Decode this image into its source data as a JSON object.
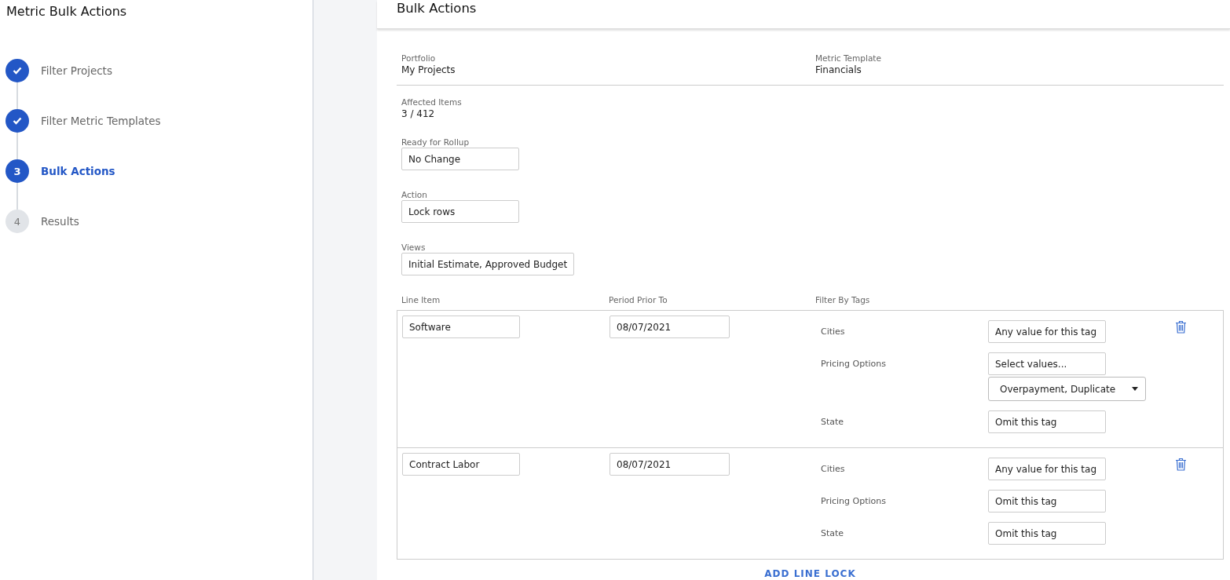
{
  "sidebar": {
    "title": "Metric Bulk Actions",
    "steps": [
      {
        "label": "Filter Projects",
        "completed": true,
        "selected": false
      },
      {
        "label": "Filter Metric Templates",
        "completed": true,
        "selected": false
      },
      {
        "marker": "3",
        "label": "Bulk Actions",
        "completed": false,
        "selected": true
      },
      {
        "marker": "4",
        "label": "Results",
        "completed": false,
        "selected": false
      }
    ]
  },
  "main": {
    "title": "Bulk Actions",
    "summary": [
      {
        "label": "Portfolio",
        "value": "My Projects"
      },
      {
        "label": "Metric Template",
        "value": "Financials"
      }
    ],
    "affected": {
      "label": "Affected Items",
      "value": "3 / 412"
    },
    "fields": [
      {
        "label": "Ready for Rollup",
        "value": "No Change"
      },
      {
        "label": "Action",
        "value": "Lock rows"
      },
      {
        "label": "Views",
        "value": "Initial Estimate, Approved Budget"
      }
    ],
    "table": {
      "columns": [
        "Line Item",
        "Period Prior To",
        "Filter By Tags"
      ],
      "rows": [
        {
          "line_item": "Software",
          "period": "08/07/2021",
          "tags": [
            {
              "label": "Cities",
              "controls": [
                {
                  "kind": "field",
                  "value": "Any value for this tag"
                }
              ]
            },
            {
              "label": "Pricing Options",
              "controls": [
                {
                  "kind": "field",
                  "value": "Select values..."
                },
                {
                  "kind": "dropdown",
                  "value": "Overpayment, Duplicate"
                }
              ]
            },
            {
              "label": "State",
              "controls": [
                {
                  "kind": "field",
                  "value": "Omit this tag"
                }
              ]
            }
          ]
        },
        {
          "line_item": "Contract Labor",
          "period": "08/07/2021",
          "tags": [
            {
              "label": "Cities",
              "controls": [
                {
                  "kind": "field",
                  "value": "Any value for this tag"
                }
              ]
            },
            {
              "label": "Pricing Options",
              "controls": [
                {
                  "kind": "field",
                  "value": "Omit this tag"
                }
              ]
            },
            {
              "label": "State",
              "controls": [
                {
                  "kind": "field",
                  "value": "Omit this tag"
                }
              ]
            }
          ]
        }
      ]
    },
    "add_button": "ADD LINE LOCK"
  }
}
